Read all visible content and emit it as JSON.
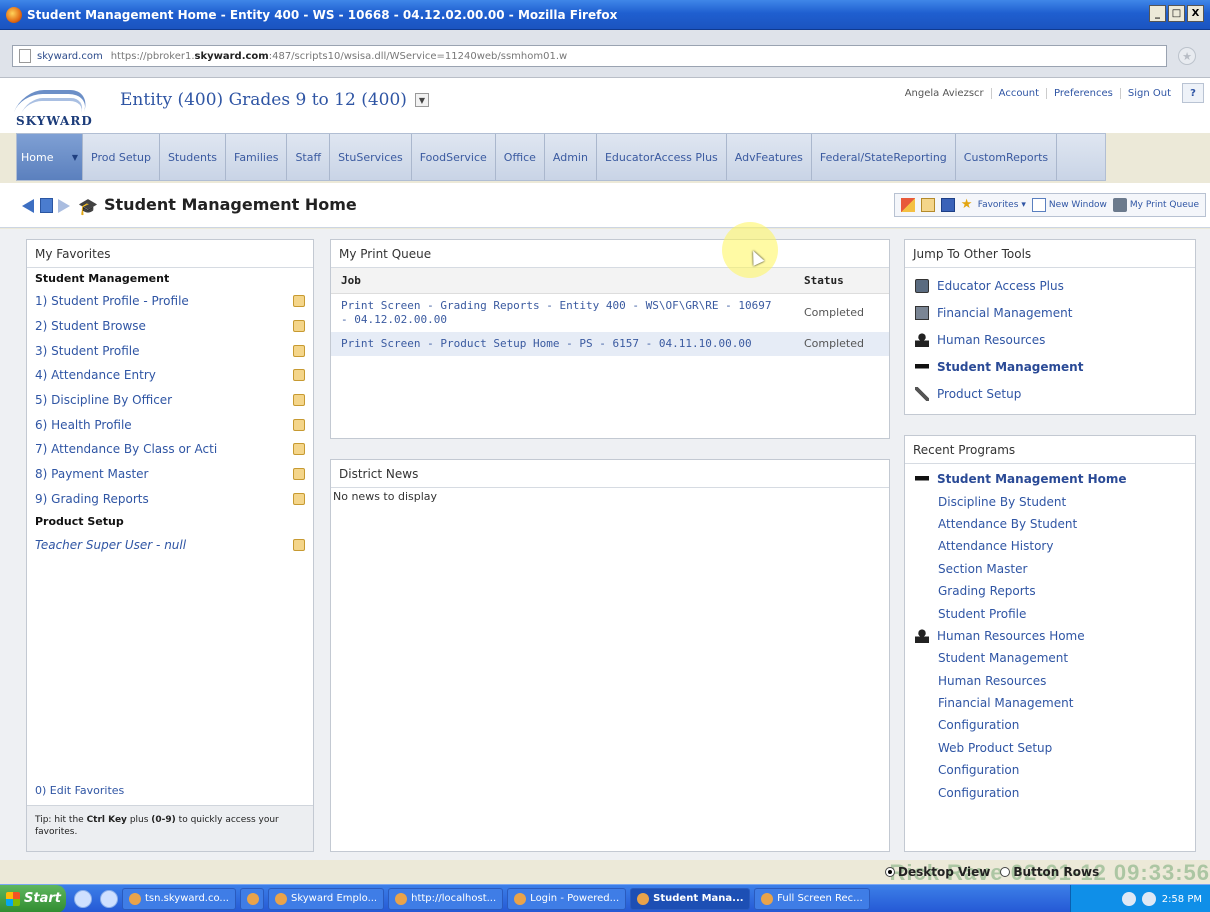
{
  "window": {
    "title": "Student Management Home - Entity 400 - WS - 10668 - 04.12.02.00.00 - Mozilla Firefox",
    "controls": [
      "_",
      "□",
      "X"
    ]
  },
  "browser": {
    "site_label": "skyward.com",
    "url_prefix": "https://pbroker1.",
    "url_domain": "skyward.com",
    "url_rest": ":487/scripts10/wsisa.dll/WService=11240web/ssmhom01.w"
  },
  "header": {
    "logo_text": "SKYWARD",
    "entity": "Entity (400) Grades 9 to 12 (400)",
    "user": "Angela Aviezscr",
    "links": [
      "Account",
      "Preferences",
      "Sign Out"
    ],
    "help": "?"
  },
  "nav": {
    "home": "Home",
    "items": [
      {
        "line1": "Prod Setup",
        "line2": ""
      },
      {
        "line1": "Students",
        "line2": ""
      },
      {
        "line1": "Families",
        "line2": ""
      },
      {
        "line1": "Staff",
        "line2": ""
      },
      {
        "line1": "Stu",
        "line2": "Services"
      },
      {
        "line1": "Food",
        "line2": "Service"
      },
      {
        "line1": "Office",
        "line2": ""
      },
      {
        "line1": "Admin",
        "line2": ""
      },
      {
        "line1": "Educator",
        "line2": "Access Plus"
      },
      {
        "line1": "Adv",
        "line2": "Features"
      },
      {
        "line1": "Federal/State",
        "line2": "Reporting"
      },
      {
        "line1": "Custom",
        "line2": "Reports"
      }
    ]
  },
  "page": {
    "title": "Student Management Home",
    "tools": {
      "favorites": "Favorites",
      "new_window": "New Window",
      "print_queue": "My Print Queue"
    }
  },
  "favorites": {
    "title": "My Favorites",
    "sections": [
      {
        "name": "Student Management",
        "items": [
          {
            "num": "1)",
            "text": "Student Profile - Profile"
          },
          {
            "num": "2)",
            "text": "Student Browse"
          },
          {
            "num": "3)",
            "text": "Student Profile"
          },
          {
            "num": "4)",
            "text": "Attendance Entry"
          },
          {
            "num": "5)",
            "text": "Discipline By Officer"
          },
          {
            "num": "6)",
            "text": "Health Profile"
          },
          {
            "num": "7)",
            "text": "Attendance By Class or Acti"
          },
          {
            "num": "8)",
            "text": "Payment Master"
          },
          {
            "num": "9)",
            "text": "Grading Reports"
          }
        ]
      },
      {
        "name": "Product Setup",
        "items": [
          {
            "num": "",
            "text": "Teacher Super User - null"
          }
        ]
      }
    ],
    "edit": "0) Edit Favorites",
    "tip_prefix": "Tip: hit the",
    "tip_key": "Ctrl Key",
    "tip_mid": "plus",
    "tip_range": "(0-9)",
    "tip_suffix": "to quickly access your favorites."
  },
  "print_queue": {
    "title": "My Print Queue",
    "columns": [
      "Job",
      "Status"
    ],
    "rows": [
      {
        "job": "Print Screen - Grading Reports - Entity 400 - WS\\OF\\GR\\RE - 10697 - 04.12.02.00.00",
        "status": "Completed"
      },
      {
        "job": "Print Screen - Product Setup Home - PS - 6157 - 04.11.10.00.00",
        "status": "Completed"
      }
    ]
  },
  "news": {
    "title": "District News",
    "empty": "No news to display"
  },
  "jump": {
    "title": "Jump To Other Tools",
    "items": [
      {
        "text": "Educator Access Plus",
        "icon": "monitor-icon",
        "bold": false
      },
      {
        "text": "Financial Management",
        "icon": "calculator-icon",
        "bold": false
      },
      {
        "text": "Human Resources",
        "icon": "person-icon",
        "bold": false
      },
      {
        "text": "Student Management",
        "icon": "graduation-cap-icon",
        "bold": true
      },
      {
        "text": "Product Setup",
        "icon": "wrench-icon",
        "bold": false
      }
    ]
  },
  "recent": {
    "title": "Recent Programs",
    "items": [
      {
        "text": "Student Management Home",
        "type": "top"
      },
      {
        "text": "Discipline By Student",
        "type": "child"
      },
      {
        "text": "Attendance By Student",
        "type": "child"
      },
      {
        "text": "Attendance History",
        "type": "child"
      },
      {
        "text": "Section Master",
        "type": "child"
      },
      {
        "text": "Grading Reports",
        "type": "child"
      },
      {
        "text": "Student Profile",
        "type": "child"
      },
      {
        "text": "Human Resources Home",
        "type": "sub"
      },
      {
        "text": "Student Management",
        "type": "child"
      },
      {
        "text": "Human Resources",
        "type": "child"
      },
      {
        "text": "Financial Management",
        "type": "child"
      },
      {
        "text": "Configuration",
        "type": "child"
      },
      {
        "text": "Web Product Setup",
        "type": "child"
      },
      {
        "text": "Configuration",
        "type": "child"
      },
      {
        "text": "Configuration",
        "type": "child"
      }
    ]
  },
  "view_options": {
    "desktop": "Desktop View",
    "buttons": "Button Rows"
  },
  "watermark": "Rick Rave 02-01-12 09:33:56",
  "taskbar": {
    "start": "Start",
    "tasks": [
      {
        "label": "tsn.skyward.co...",
        "active": false
      },
      {
        "label": "",
        "active": false
      },
      {
        "label": "Skyward Emplo...",
        "active": false
      },
      {
        "label": "http://localhost...",
        "active": false
      },
      {
        "label": "Login - Powered...",
        "active": false
      },
      {
        "label": "Student Mana...",
        "active": true
      },
      {
        "label": "Full Screen Rec...",
        "active": false
      }
    ],
    "clock": "2:58 PM"
  },
  "colors": {
    "link": "#2f55a4",
    "nav_home": "#5b80be",
    "titlebar": "#1f5fd0"
  }
}
